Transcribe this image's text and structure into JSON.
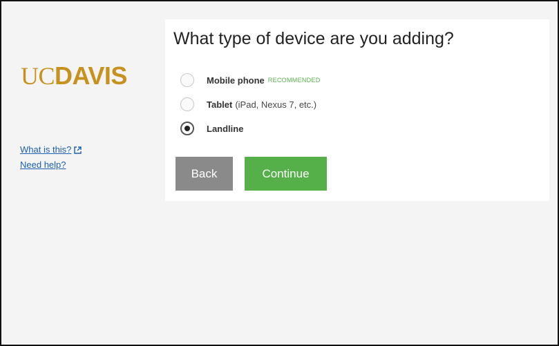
{
  "brand": {
    "logo_uc": "UC",
    "logo_davis": "DAVIS",
    "color": "#c6911c"
  },
  "sidebar": {
    "links": [
      {
        "label": "What is this?"
      },
      {
        "label": "Need help?"
      }
    ]
  },
  "form": {
    "heading": "What type of device are you adding?",
    "options": [
      {
        "label": "Mobile phone",
        "note": "",
        "badge": "RECOMMENDED",
        "selected": false
      },
      {
        "label": "Tablet",
        "note": "(iPad, Nexus 7, etc.)",
        "badge": "",
        "selected": false
      },
      {
        "label": "Landline",
        "note": "",
        "badge": "",
        "selected": true
      }
    ],
    "buttons": {
      "back": "Back",
      "continue": "Continue"
    }
  },
  "colors": {
    "accent_green": "#55b04a",
    "back_gray": "#8a8a8a",
    "link_blue": "#1a5fb4"
  }
}
